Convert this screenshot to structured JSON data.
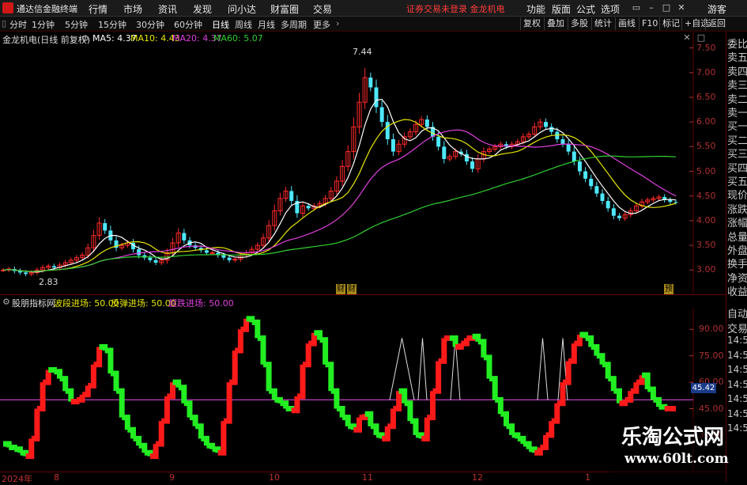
{
  "titlebar": {
    "app_name": "通达信金融终端",
    "menus": [
      "行情",
      "市场",
      "资讯",
      "发现",
      "问小达",
      "财富圈",
      "交易"
    ],
    "notice": "证券交易未登录  金龙机电",
    "right_menus": [
      "功能",
      "版面",
      "公式",
      "选项"
    ],
    "guest": "游客"
  },
  "tabbar": {
    "periods": [
      "分时",
      "1分钟",
      "5分钟",
      "15分钟",
      "30分钟",
      "60分钟",
      "日线",
      "周线",
      "月线",
      "多周期",
      "更多"
    ],
    "active": "日线",
    "right_buttons": [
      "复权",
      "叠加",
      "多股",
      "统计",
      "画线",
      "F10",
      "标记",
      "+自选",
      "返回"
    ]
  },
  "main_chart": {
    "stock_label": "金龙机电(日线 前复权)",
    "ma": [
      {
        "label": "MA5: 4.37",
        "color": "#ffffff"
      },
      {
        "label": "MA10: 4.43",
        "color": "#e8e800"
      },
      {
        "label": "MA20: 4.37",
        "color": "#e040e0"
      },
      {
        "label": "MA60: 5.07",
        "color": "#30d030"
      }
    ],
    "high_label": "7.44",
    "low_label": "2.83",
    "markers": [
      "财",
      "财",
      "预"
    ],
    "y_ticks": [
      "7.50",
      "7.00",
      "6.50",
      "6.00",
      "5.50",
      "5.00",
      "4.50",
      "4.00",
      "3.50",
      "3.00"
    ],
    "y_range": [
      2.7,
      7.75
    ]
  },
  "indicator": {
    "title": "股朋指标网",
    "lines": [
      {
        "label": "波段进场: 50.00",
        "color": "#e8e800"
      },
      {
        "label": "反弹进场: 50.00",
        "color": "#e8e800"
      },
      {
        "label": "超跌进场: 50.00",
        "color": "#e040e0"
      }
    ],
    "current_value": "45.42",
    "y_ticks": [
      "90.00",
      "75.00",
      "60.00",
      "45.00",
      "30.00"
    ],
    "y_range": [
      12,
      100
    ]
  },
  "right_column": {
    "labels": [
      "委比",
      "卖五",
      "卖四",
      "卖三",
      "卖二",
      "卖一",
      "买一",
      "买二",
      "买三",
      "买四",
      "买五",
      "现价",
      "涨跌",
      "涨幅",
      "总量",
      "外盘",
      "换手",
      "净资",
      "收益"
    ],
    "lower_labels": [
      "自动",
      "交易",
      "14:56",
      "14:56",
      "14:56",
      "14:56",
      "14:56",
      "14:56",
      "14:56"
    ]
  },
  "x_axis": {
    "labels": [
      "2024年",
      "8",
      "9",
      "10",
      "11",
      "12",
      "1"
    ]
  },
  "watermark": {
    "title": "乐淘公式网",
    "url": "www.60lt.com"
  },
  "colors": {
    "up": "#ff2a2a",
    "down": "#4ee8ff",
    "ind_up": "#ff1a1a",
    "ind_down": "#22ee22",
    "ma5": "#ffffff",
    "ma10": "#e8e800",
    "ma20": "#e040e0",
    "ma60": "#30d030"
  },
  "chart_data": {
    "type": "candlestick",
    "count": 120,
    "close": [
      3.0,
      3.02,
      2.98,
      2.95,
      2.92,
      2.95,
      3.0,
      3.05,
      3.08,
      3.05,
      3.1,
      3.15,
      3.2,
      3.25,
      3.3,
      3.45,
      3.7,
      3.95,
      3.8,
      3.6,
      3.45,
      3.5,
      3.55,
      3.42,
      3.3,
      3.25,
      3.2,
      3.15,
      3.2,
      3.35,
      3.55,
      3.75,
      3.6,
      3.5,
      3.45,
      3.4,
      3.35,
      3.35,
      3.3,
      3.25,
      3.2,
      3.22,
      3.3,
      3.35,
      3.42,
      3.5,
      3.65,
      3.9,
      4.2,
      4.45,
      4.6,
      4.4,
      4.15,
      4.3,
      4.25,
      4.3,
      4.35,
      4.45,
      4.6,
      4.8,
      5.1,
      5.4,
      5.9,
      6.4,
      6.9,
      6.7,
      6.3,
      6.0,
      5.65,
      5.4,
      5.55,
      5.7,
      5.8,
      5.95,
      6.05,
      5.9,
      5.7,
      5.5,
      5.25,
      5.3,
      5.4,
      5.35,
      5.2,
      5.05,
      5.25,
      5.4,
      5.45,
      5.5,
      5.55,
      5.5,
      5.55,
      5.6,
      5.7,
      5.75,
      5.9,
      6.0,
      5.9,
      5.8,
      5.65,
      5.55,
      5.4,
      5.2,
      5.0,
      4.85,
      4.7,
      4.55,
      4.4,
      4.25,
      4.1,
      4.05,
      4.12,
      4.2,
      4.3,
      4.38,
      4.42,
      4.45,
      4.48,
      4.42,
      4.38,
      4.37
    ],
    "indicator": [
      25,
      23,
      22,
      20,
      18,
      28,
      45,
      60,
      67,
      66,
      62,
      55,
      49,
      50,
      53,
      58,
      70,
      80,
      78,
      65,
      55,
      40,
      33,
      28,
      24,
      20,
      18,
      25,
      38,
      52,
      60,
      57,
      48,
      40,
      35,
      28,
      24,
      22,
      20,
      38,
      60,
      78,
      90,
      96,
      94,
      85,
      70,
      55,
      50,
      48,
      45,
      44,
      52,
      70,
      82,
      88,
      84,
      70,
      55,
      45,
      40,
      35,
      33,
      40,
      42,
      35,
      30,
      28,
      35,
      45,
      55,
      48,
      38,
      30,
      28,
      40,
      55,
      72,
      85,
      85,
      80,
      82,
      85,
      86,
      83,
      74,
      62,
      50,
      42,
      35,
      30,
      28,
      25,
      22,
      20,
      23,
      30,
      38,
      48,
      60,
      72,
      82,
      87,
      85,
      80,
      75,
      70,
      62,
      55,
      48,
      50,
      55,
      60,
      64,
      56,
      50,
      46,
      45,
      45,
      45
    ]
  }
}
